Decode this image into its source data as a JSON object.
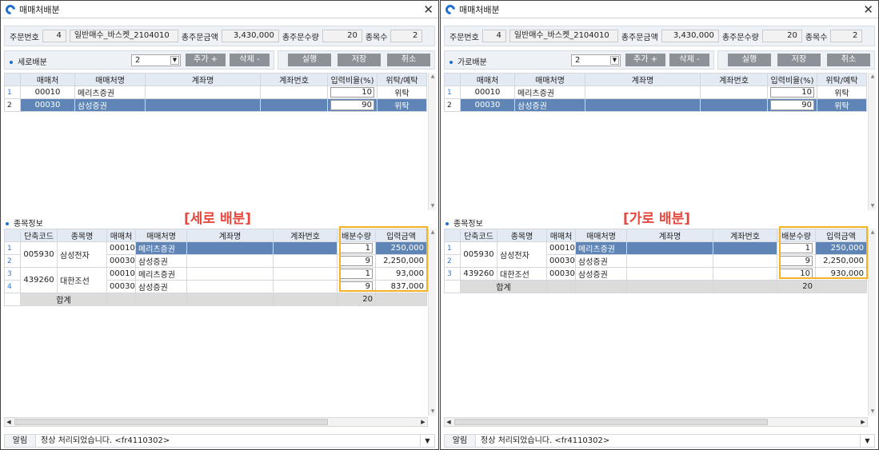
{
  "windows": [
    {
      "title": "매매처배분",
      "info": {
        "order_no_label": "주문번호",
        "order_no": "4",
        "order_name": "일반매수_바스켓_2104010",
        "total_amount_label": "총주문금액",
        "total_amount": "3,430,000",
        "total_qty_label": "총주문수량",
        "total_qty": "20",
        "items_label": "종목수",
        "items": "2"
      },
      "toolbar": {
        "section_label": "세로배분",
        "select_value": "2",
        "add_label": "추가 +",
        "delete_label": "삭제 -",
        "run_label": "실행",
        "save_label": "저장",
        "cancel_label": "취소"
      },
      "broker_headers": [
        "매매처",
        "매매처명",
        "계좌명",
        "계좌번호",
        "입력비율(%)",
        "위탁/예탁"
      ],
      "broker_rows": [
        {
          "n": "1",
          "code": "00010",
          "name": "메리츠증권",
          "acct_name": "",
          "acct_no": "",
          "ratio": "10",
          "type": "위탁"
        },
        {
          "n": "2",
          "code": "00030",
          "name": "삼성증권",
          "acct_name": "",
          "acct_no": "",
          "ratio": "90",
          "type": "위탁"
        }
      ],
      "item_section_label": "종목정보",
      "overlay_label": "[세로 배분]",
      "item_headers": [
        "단축코드",
        "종목명",
        "매매처",
        "매매처명",
        "계좌명",
        "계좌번호",
        "배분수량",
        "입력금액"
      ],
      "item_rows": [
        {
          "n": "1",
          "code": "005930",
          "name": "삼성전자",
          "broker": "00010",
          "broker_name": "메리츠증권",
          "qty": "1",
          "amount": "250,000"
        },
        {
          "n": "2",
          "broker": "00030",
          "broker_name": "삼성증권",
          "qty": "9",
          "amount": "2,250,000"
        },
        {
          "n": "3",
          "code": "439260",
          "name": "대한조선",
          "broker": "00010",
          "broker_name": "메리츠증권",
          "qty": "1",
          "amount": "93,000"
        },
        {
          "n": "4",
          "broker": "00030",
          "broker_name": "삼성증권",
          "qty": "9",
          "amount": "837,000"
        }
      ],
      "sum_label": "합계",
      "sum_qty": "20",
      "status": {
        "label": "알림",
        "message": "정상 처리되었습니다. <fr4110302>"
      }
    },
    {
      "title": "매매처배분",
      "info": {
        "order_no_label": "주문번호",
        "order_no": "4",
        "order_name": "일반매수_바스켓_2104010",
        "total_amount_label": "총주문금액",
        "total_amount": "3,430,000",
        "total_qty_label": "총주문수량",
        "total_qty": "20",
        "items_label": "종목수",
        "items": "2"
      },
      "toolbar": {
        "section_label": "가로배분",
        "select_value": "2",
        "add_label": "추가 +",
        "delete_label": "삭제 -",
        "run_label": "실행",
        "save_label": "저장",
        "cancel_label": "취소"
      },
      "broker_headers": [
        "매매처",
        "매매처명",
        "계좌명",
        "계좌번호",
        "입력비율(%)",
        "위탁/예탁"
      ],
      "broker_rows": [
        {
          "n": "1",
          "code": "00010",
          "name": "메리츠증권",
          "acct_name": "",
          "acct_no": "",
          "ratio": "10",
          "type": "위탁"
        },
        {
          "n": "2",
          "code": "00030",
          "name": "삼성증권",
          "acct_name": "",
          "acct_no": "",
          "ratio": "90",
          "type": "위탁"
        }
      ],
      "item_section_label": "종목정보",
      "overlay_label": "[가로 배분]",
      "item_headers": [
        "단축코드",
        "종목명",
        "매매처",
        "매매처명",
        "계좌명",
        "계좌번호",
        "배분수량",
        "입력금액"
      ],
      "item_rows": [
        {
          "n": "1",
          "code": "005930",
          "name": "삼성전자",
          "broker": "00010",
          "broker_name": "메리츠증권",
          "qty": "1",
          "amount": "250,000"
        },
        {
          "n": "2",
          "broker": "00030",
          "broker_name": "삼성증권",
          "qty": "9",
          "amount": "2,250,000"
        },
        {
          "n": "3",
          "code": "439260",
          "name": "대한조선",
          "broker": "00030",
          "broker_name": "삼성증권",
          "qty": "10",
          "amount": "930,000"
        }
      ],
      "sum_label": "합계",
      "sum_qty": "20",
      "status": {
        "label": "알림",
        "message": "정상 처리되었습니다. <fr4110302>"
      }
    }
  ]
}
